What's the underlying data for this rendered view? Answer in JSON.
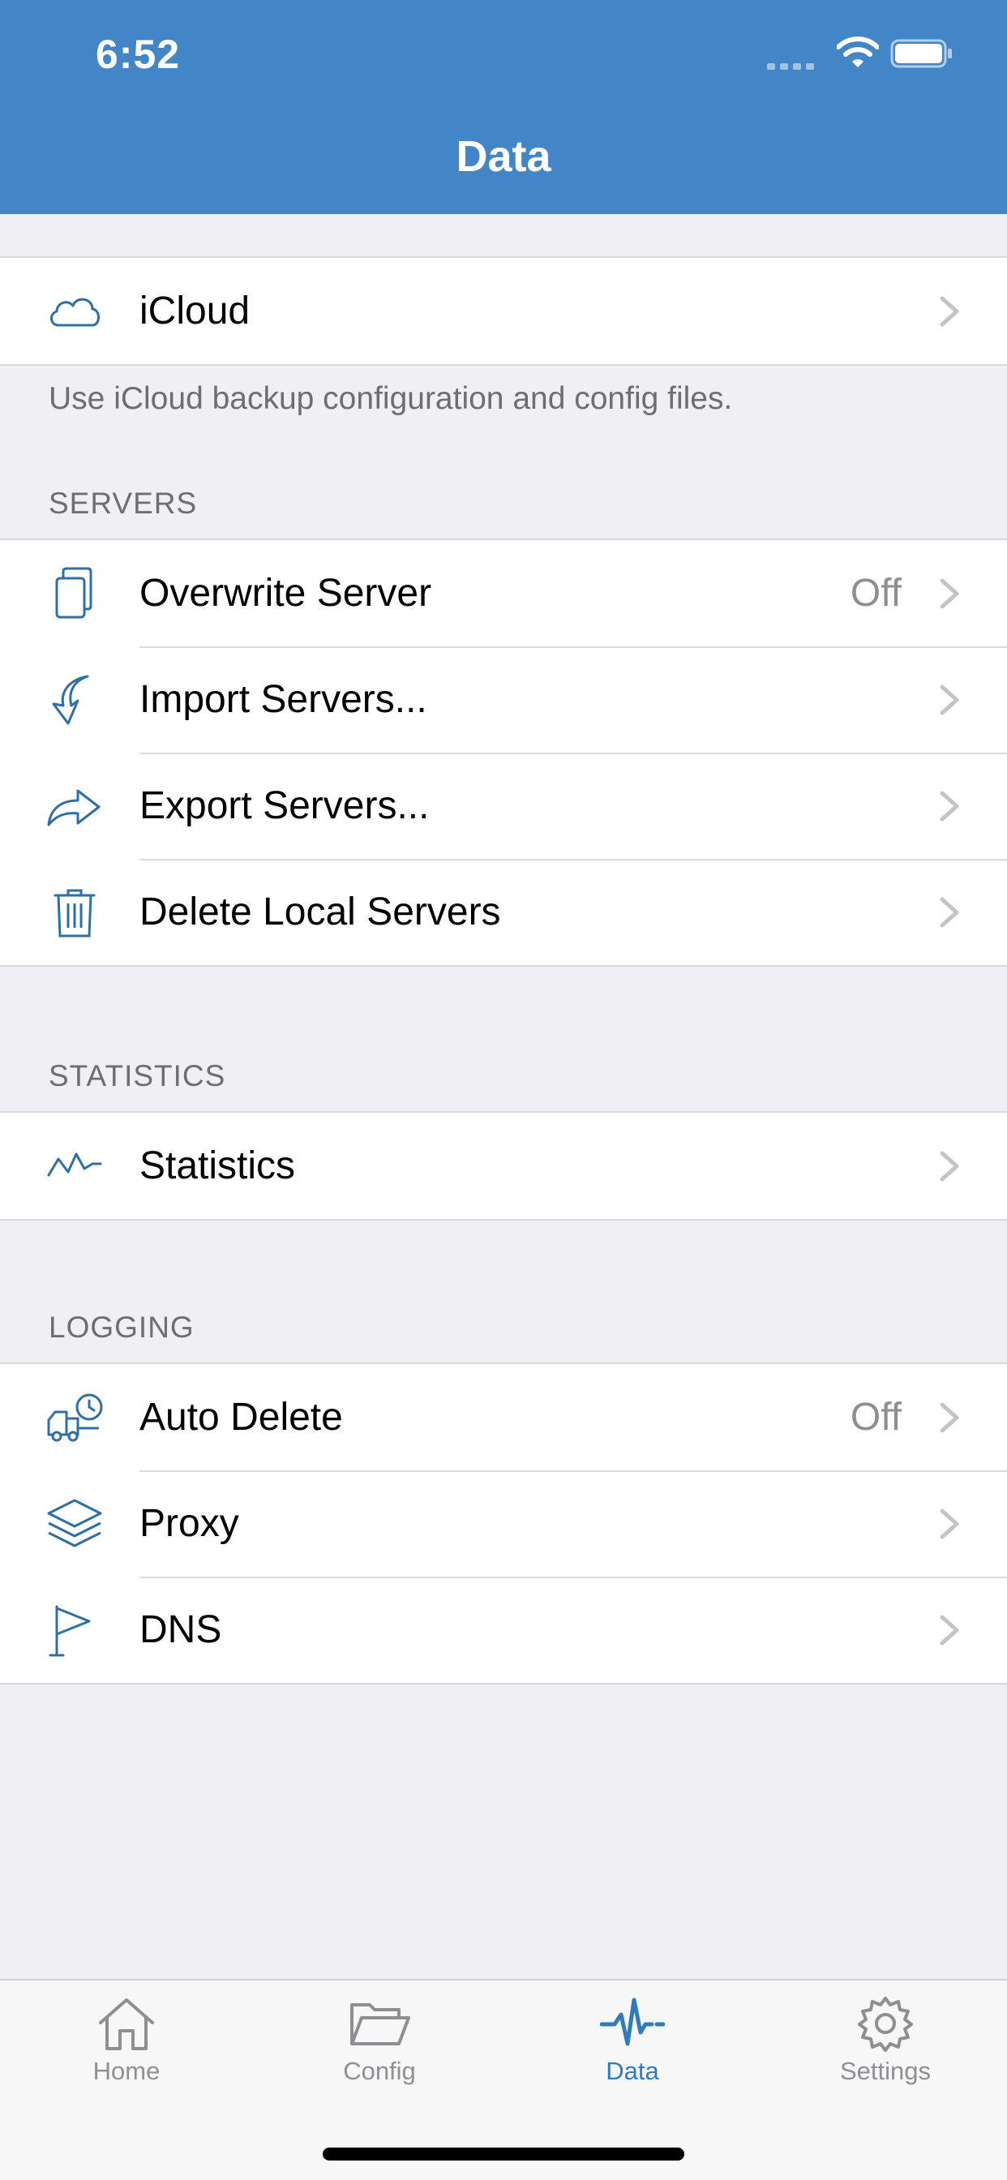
{
  "status_bar": {
    "time": "6:52"
  },
  "nav": {
    "title": "Data"
  },
  "icloud": {
    "label": "iCloud",
    "icon": "cloud-icon",
    "footer": "Use iCloud backup configuration and config files."
  },
  "servers": {
    "header": "SERVERS",
    "items": [
      {
        "label": "Overwrite Server",
        "value": "Off",
        "icon": "copy-icon"
      },
      {
        "label": "Import Servers...",
        "value": "",
        "icon": "import-arrow-icon"
      },
      {
        "label": "Export Servers...",
        "value": "",
        "icon": "share-arrow-icon"
      },
      {
        "label": "Delete Local Servers",
        "value": "",
        "icon": "trash-icon"
      }
    ]
  },
  "statistics": {
    "header": "STATISTICS",
    "items": [
      {
        "label": "Statistics",
        "value": "",
        "icon": "pulse-icon"
      }
    ]
  },
  "logging": {
    "header": "LOGGING",
    "items": [
      {
        "label": "Auto Delete",
        "value": "Off",
        "icon": "truck-clock-icon"
      },
      {
        "label": "Proxy",
        "value": "",
        "icon": "layers-icon"
      },
      {
        "label": "DNS",
        "value": "",
        "icon": "flag-icon"
      }
    ]
  },
  "tabbar": {
    "items": [
      {
        "label": "Home",
        "icon": "home-icon",
        "active": false
      },
      {
        "label": "Config",
        "icon": "folder-icon",
        "active": false
      },
      {
        "label": "Data",
        "icon": "pulse-icon",
        "active": true
      },
      {
        "label": "Settings",
        "icon": "gear-icon",
        "active": false
      }
    ]
  },
  "colors": {
    "header_bg": "#4286c7",
    "accent": "#2f7bbf",
    "icon_stroke": "#2f6fa8",
    "secondary_text": "#8e8e93",
    "background": "#efeff4"
  }
}
